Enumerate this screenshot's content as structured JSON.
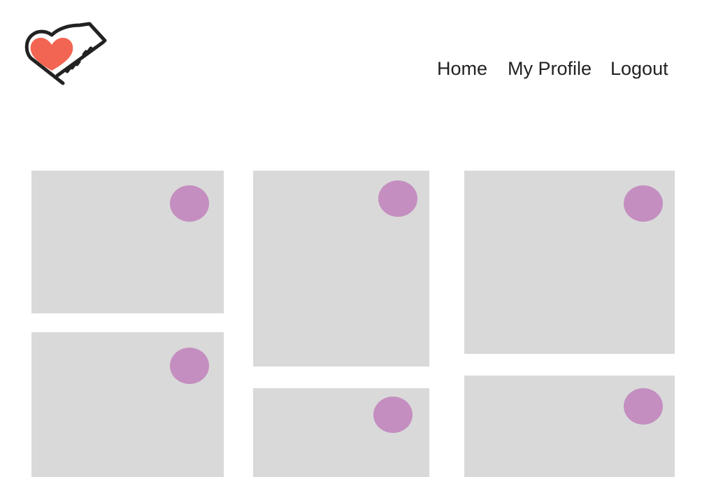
{
  "header": {
    "logo_icon": "heart-piano-logo-icon",
    "nav": [
      {
        "label": "Home"
      },
      {
        "label": "My Profile"
      },
      {
        "label": "Logout"
      }
    ]
  },
  "grid": {
    "card_color": "#d9d9d9",
    "dot_color": "#c48ec0",
    "card_count": 6
  },
  "colors": {
    "heart": "#f26552",
    "outline": "#222222",
    "nav_text": "#222222"
  }
}
